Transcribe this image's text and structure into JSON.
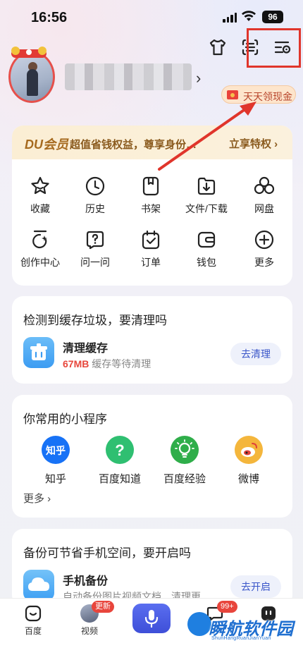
{
  "status_bar": {
    "time": "16:56",
    "battery": "96"
  },
  "profile": {
    "cash_pill": "天天领现金"
  },
  "du_bar": {
    "brand": "DU会员",
    "desc": "超值省钱权益，尊享身份…",
    "cta": "立享特权 ›"
  },
  "shortcuts": [
    {
      "label": "收藏",
      "icon": "star-icon"
    },
    {
      "label": "历史",
      "icon": "clock-icon"
    },
    {
      "label": "书架",
      "icon": "bookshelf-icon"
    },
    {
      "label": "文件/下载",
      "icon": "download-folder-icon"
    },
    {
      "label": "网盘",
      "icon": "cloud-drive-icon"
    },
    {
      "label": "创作中心",
      "icon": "creator-icon"
    },
    {
      "label": "问一问",
      "icon": "ask-icon"
    },
    {
      "label": "订单",
      "icon": "order-icon"
    },
    {
      "label": "钱包",
      "icon": "wallet-icon"
    },
    {
      "label": "更多",
      "icon": "plus-circle-icon"
    }
  ],
  "cache_card": {
    "title": "检测到缓存垃圾，要清理吗",
    "item_title": "清理缓存",
    "size": "67MB",
    "sub": " 缓存等待清理",
    "button": "去清理"
  },
  "mini_programs": {
    "title": "你常用的小程序",
    "items": [
      {
        "label": "知乎",
        "icon_text": "知乎",
        "color": "#1772f6"
      },
      {
        "label": "百度知道",
        "icon_text": "?",
        "color": "#2fbf71"
      },
      {
        "label": "百度经验",
        "icon_text": "",
        "color": "#2fae4a"
      },
      {
        "label": "微博",
        "icon_text": "",
        "color": "#f4b63c"
      }
    ],
    "more": "更多 ›"
  },
  "backup_card": {
    "title": "备份可节省手机空间，要开启吗",
    "item_title": "手机备份",
    "sub": "自动备份图片视频文档、清理更…",
    "button": "去开启"
  },
  "bottom_nav": {
    "home": "百度",
    "video": "视频",
    "video_badge": "更新",
    "msg_badge": "99+"
  },
  "watermark": {
    "text": "瞬航软件园",
    "sub": "ShunHangRuanJianYuan"
  },
  "colors": {
    "accent": "#3a56c9",
    "highlight": "#e0352b",
    "du_gold": "#8a5a1d"
  }
}
